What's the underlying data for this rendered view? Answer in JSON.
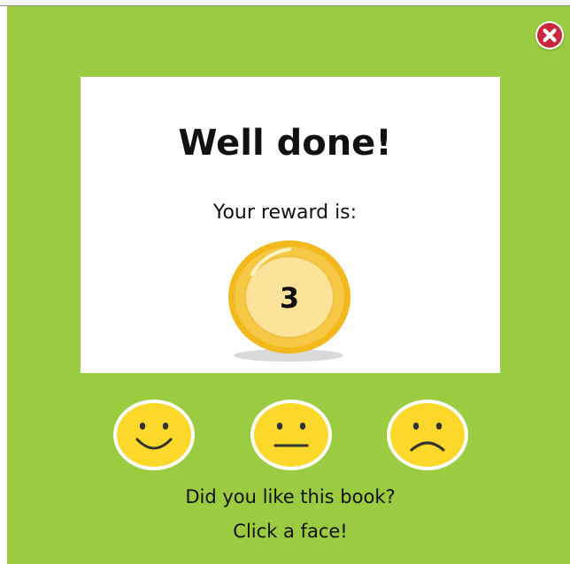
{
  "dialog": {
    "title": "Well done!",
    "reward_label": "Your reward is:",
    "reward_value": "3",
    "question": "Did you like this book?",
    "instruction": "Click a face!"
  },
  "faces": [
    {
      "name": "happy-face-icon",
      "mood": "happy"
    },
    {
      "name": "neutral-face-icon",
      "mood": "neutral"
    },
    {
      "name": "sad-face-icon",
      "mood": "sad"
    }
  ],
  "icons": {
    "close": "close-icon",
    "coin": "coin-icon"
  },
  "colors": {
    "background": "#9acb40",
    "card": "#ffffff",
    "coin_outer": "#f2b81c",
    "coin_inner": "#fde39a",
    "face": "#fbd82a",
    "close": "#c8283c",
    "text": "#111111"
  }
}
